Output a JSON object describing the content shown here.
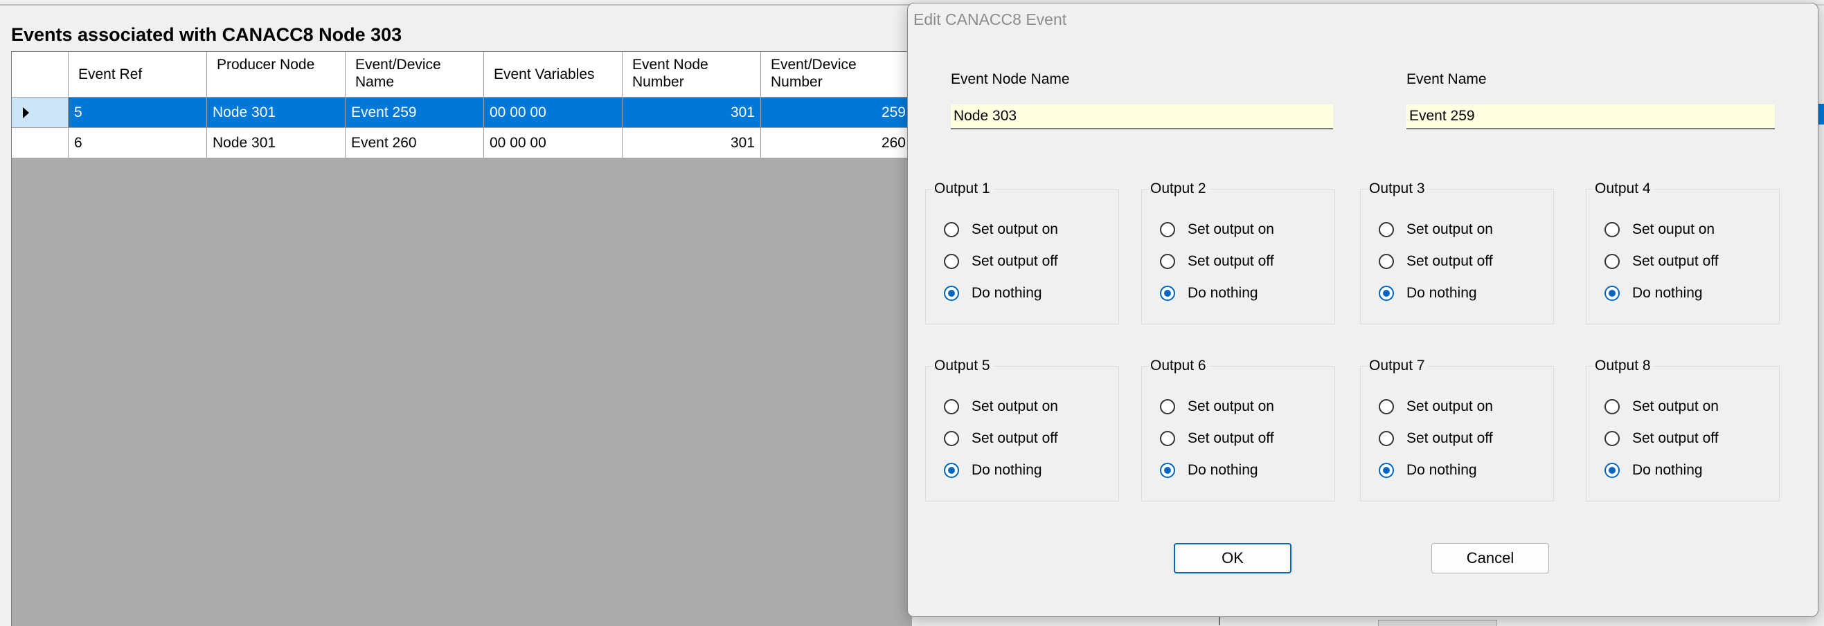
{
  "main": {
    "title": "Events associated with CANACC8 Node 303",
    "columns": [
      "",
      "Event Ref",
      "Producer Node",
      "Event/Device Name",
      "Event Variables",
      "Event Node Number",
      "Event/Device Number"
    ],
    "rows": [
      {
        "event_ref": "5",
        "producer_node": "Node 301",
        "name": "Event 259",
        "variables": "00 00 00",
        "node_number": "301",
        "device_number": "259",
        "selected": true
      },
      {
        "event_ref": "6",
        "producer_node": "Node 301",
        "name": "Event 260",
        "variables": "00 00 00",
        "node_number": "301",
        "device_number": "260",
        "selected": false
      }
    ]
  },
  "dialog": {
    "title": "Edit CANACC8 Event",
    "event_node_name_label": "Event Node Name",
    "event_node_name_value": "Node 303",
    "event_name_label": "Event Name",
    "event_name_value": "Event 259",
    "outputs": [
      {
        "label": "Output 1",
        "options": [
          "Set  output on",
          "Set output off",
          "Do nothing"
        ],
        "selected": 2
      },
      {
        "label": "Output 2",
        "options": [
          "Set output on",
          "Set output off",
          "Do nothing"
        ],
        "selected": 2
      },
      {
        "label": "Output 3",
        "options": [
          "Set output on",
          "Set output off",
          "Do nothing"
        ],
        "selected": 2
      },
      {
        "label": "Output 4",
        "options": [
          "Set ouput on",
          "Set output off",
          "Do nothing"
        ],
        "selected": 2
      },
      {
        "label": "Output 5",
        "options": [
          "Set output on",
          "Set output off",
          "Do nothing"
        ],
        "selected": 2
      },
      {
        "label": "Output 6",
        "options": [
          "Set output on",
          "Set output off",
          "Do nothing"
        ],
        "selected": 2
      },
      {
        "label": "Output 7",
        "options": [
          "Set  output on",
          "Set output off",
          "Do nothing"
        ],
        "selected": 2
      },
      {
        "label": "Output 8",
        "options": [
          "Set output on",
          "Set output off",
          "Do nothing"
        ],
        "selected": 2
      }
    ],
    "ok_label": "OK",
    "cancel_label": "Cancel"
  },
  "colors": {
    "selection": "#0078d7",
    "row_header_selected": "#cce4f7",
    "input_background": "#ffffe1",
    "radio_accent": "#0067c0",
    "grid_background": "#ababab"
  }
}
